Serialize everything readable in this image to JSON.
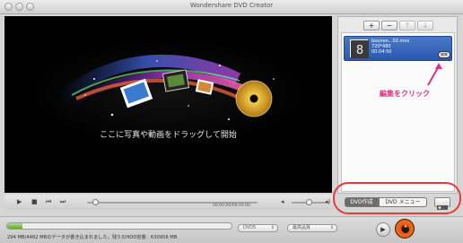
{
  "window": {
    "title": "Wondershare DVD Creator"
  },
  "preview": {
    "drop_hint": "ここに写真や動画をドラッグして開始"
  },
  "right_panel": {
    "toolbar": {
      "add_label": "+",
      "remove_label": "−",
      "up_label": "↑",
      "down_label": "↓"
    },
    "clip": {
      "name": "bounen...02.mov",
      "resolution": "720*480",
      "duration": "00:04:50",
      "edit_label": "編集"
    },
    "annotation": "編集をクリック"
  },
  "transport": {
    "timecode": "00:00:00/00:00:00"
  },
  "modes": {
    "create_label": "DVD作成",
    "menu_label": "DVD メニュー"
  },
  "bottom": {
    "capacity_fraction": 0.066,
    "status": "294 MB/4482 MBのデータが書き込まれました。残りのHDD容量：630956 MB",
    "disc_type": "DVD5",
    "quality": "最高品質"
  },
  "colors": {
    "highlight": "#e43c3c",
    "annotation": "#e0317c",
    "clip_selected": "#2a58b0"
  }
}
